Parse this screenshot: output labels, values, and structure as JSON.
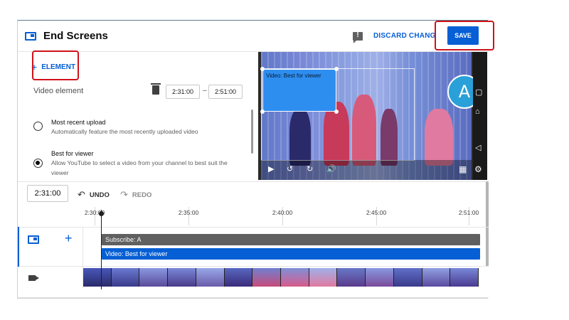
{
  "header": {
    "title": "End Screens",
    "discard_label": "DISCARD CHANGES",
    "save_label": "SAVE"
  },
  "editor": {
    "add_element_label": "ELEMENT",
    "video_element_label": "Video element",
    "start_time": "2:31:00",
    "end_time": "2:51:00",
    "options": [
      {
        "title": "Most recent upload",
        "description": "Automatically feature the most recently uploaded video",
        "selected": false
      },
      {
        "title": "Best for viewer",
        "description": "Allow YouTube to select a video from your channel to best suit the viewer",
        "selected": true
      }
    ]
  },
  "preview": {
    "endcard_label": "Video: Best for viewer",
    "avatar_letter": "A"
  },
  "timeline": {
    "current_time": "2:31:00",
    "undo_label": "UNDO",
    "redo_label": "REDO",
    "ticks": [
      "2:30:00",
      "2:35:00",
      "2:40:00",
      "2:45:00",
      "2:51:00"
    ],
    "tracks": [
      {
        "label": "Subscribe: A",
        "color": "#606060"
      },
      {
        "label": "Video: Best for viewer",
        "color": "#065fd4"
      }
    ]
  },
  "colors": {
    "accent": "#065fd4",
    "highlight": "#d0121b"
  }
}
